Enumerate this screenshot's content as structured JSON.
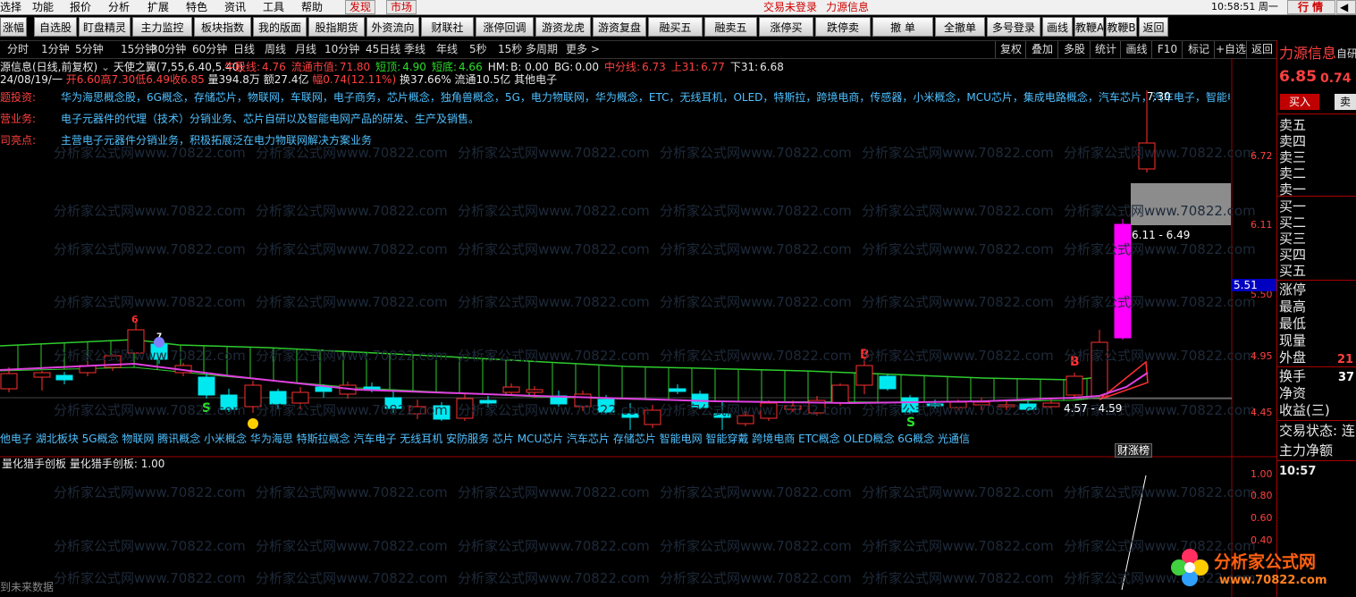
{
  "menu": {
    "items": [
      "选择",
      "功能",
      "报价",
      "分析",
      "扩展",
      "特色",
      "资讯",
      "工具",
      "帮助"
    ],
    "boxed": [
      "发现",
      "市场"
    ],
    "status1": "交易未登录",
    "status2": "力源信息",
    "time": "10:58:51 周一",
    "trade": "行 情",
    "nav": "◀"
  },
  "toolbar": [
    "涨幅",
    "自选股",
    "盯盘精灵",
    "主力监控",
    "板块指数",
    "我的版面",
    "股指期货",
    "外资流向",
    "财联社",
    "涨停回调",
    "游资龙虎",
    "游资复盘",
    "融买五",
    "融卖五",
    "涨停买",
    "跌停卖",
    "撤 单",
    "全撤单",
    "多号登录",
    "画线",
    "教鞭A",
    "教鞭B",
    "返回"
  ],
  "periods": [
    "分时",
    "1分钟",
    "5分钟",
    "15分钟",
    "30分钟",
    "60分钟",
    "日线",
    "周线",
    "月线",
    "10分钟",
    "45日线",
    "季线",
    "年线",
    "5秒",
    "15秒",
    "多周期",
    "更多 >"
  ],
  "period_right": [
    "复权",
    "叠加",
    "多股",
    "统计",
    "画线",
    "F10",
    "标记",
    "+自选",
    "返回"
  ],
  "stock": {
    "title": "源信息(日线,前复权)",
    "indicator": "天使之翼(7,55,6.40,5.40)",
    "labels": [
      {
        "k": "牛股线:",
        "v": "4.76"
      },
      {
        "k": "流通市值:",
        "v": "71.80"
      },
      {
        "k": "短顶:",
        "v": "4.90"
      },
      {
        "k": "短底:",
        "v": "4.66"
      },
      {
        "k": "HM:",
        "v": "B: 0.00"
      },
      {
        "k": "BG:",
        "v": "0.00"
      },
      {
        "k": "中分线:",
        "v": "6.73"
      },
      {
        "k": "上31:",
        "v": "6.77"
      },
      {
        "k": "下31:",
        "v": "6.68"
      }
    ],
    "ohlc_date": "24/08/19/一",
    "open": "开6.60",
    "high": "高7.30",
    "low": "低6.49",
    "close": "收6.85",
    "volume": "量394.8万",
    "amount": "额27.4亿",
    "change": "幅0.74(12.11%)",
    "turnover": "换37.66% 流通10.5亿",
    "sector": "其他电子"
  },
  "info": {
    "theme_label": "题投资:",
    "theme_text": "华为海思概念股，6G概念，存储芯片，物联网，车联网，电子商务，芯片概念，独角兽概念，5G，电力物联网，华为概念，ETC，无线耳机，OLED，特斯拉，跨境电商，传感器，小米概念，MCU芯片，集成电路概念，汽车芯片，汽车电子，智能电",
    "biz_label": "营业务:",
    "biz_text": "电子元器件的代理（技术）分销业务、芯片自研以及智能电网产品的研发、生产及销售。",
    "high_label": "司亮点:",
    "high_text": "主营电子元器件分销业务，积极拓展泛在电力物联网解决方案业务"
  },
  "concepts": "他电子 湖北板块 5G概念 物联网 腾讯概念 小米概念 华为海思 特斯拉概念 汽车电子 无线耳机 安防服务 芯片 MCU芯片 汽车芯片 存储芯片 智能电网 智能穿戴 跨境电商 ETC概念 OLED概念 6G概念 光通信",
  "chart_marks": {
    "range_top": "6.11 - 6.49",
    "range_bottom": "4.57 - 4.59",
    "peak": "7.30",
    "b_label": "B",
    "s_label": "S",
    "six_label": "6",
    "seven_label": "7",
    "cai": "财涨榜",
    "price_tag": "5.51"
  },
  "price_axis": [
    "6.72",
    "6.11",
    "5.50",
    "4.95",
    "4.45"
  ],
  "sub_axis": [
    "1.00",
    "0.80",
    "0.60",
    "0.40"
  ],
  "sub": {
    "title": "量化猎手创板",
    "value_label": "量化猎手创板: 1.00",
    "footer": "到未来数据"
  },
  "right_panel": {
    "name": "力源信息",
    "tag": "自研",
    "price": "6.85",
    "change": "0.74",
    "buy": "买入",
    "sell": "卖",
    "sell_levels": [
      "卖五",
      "卖四",
      "卖三",
      "卖二",
      "卖一"
    ],
    "buy_levels": [
      "买一",
      "买二",
      "买三",
      "买四",
      "买五"
    ],
    "stats": [
      "涨停",
      "最高",
      "最低",
      "现量",
      "外盘"
    ],
    "outer_value": "21",
    "stats2": [
      "换手",
      "净资",
      "收益(三)"
    ],
    "turn_value": "37",
    "status": "交易状态: 连",
    "net": "主力净额",
    "time": "10:57"
  },
  "watermark": "分析家公式网www.70822.com",
  "logo": {
    "cn": "分析家公式网",
    "url": "www.70822.com"
  },
  "colors": {
    "up": "#ff3030",
    "down": "#00e8f0",
    "wing": "#2ecc2e",
    "ma": "#e040e0",
    "info": "#3fb0ff"
  }
}
